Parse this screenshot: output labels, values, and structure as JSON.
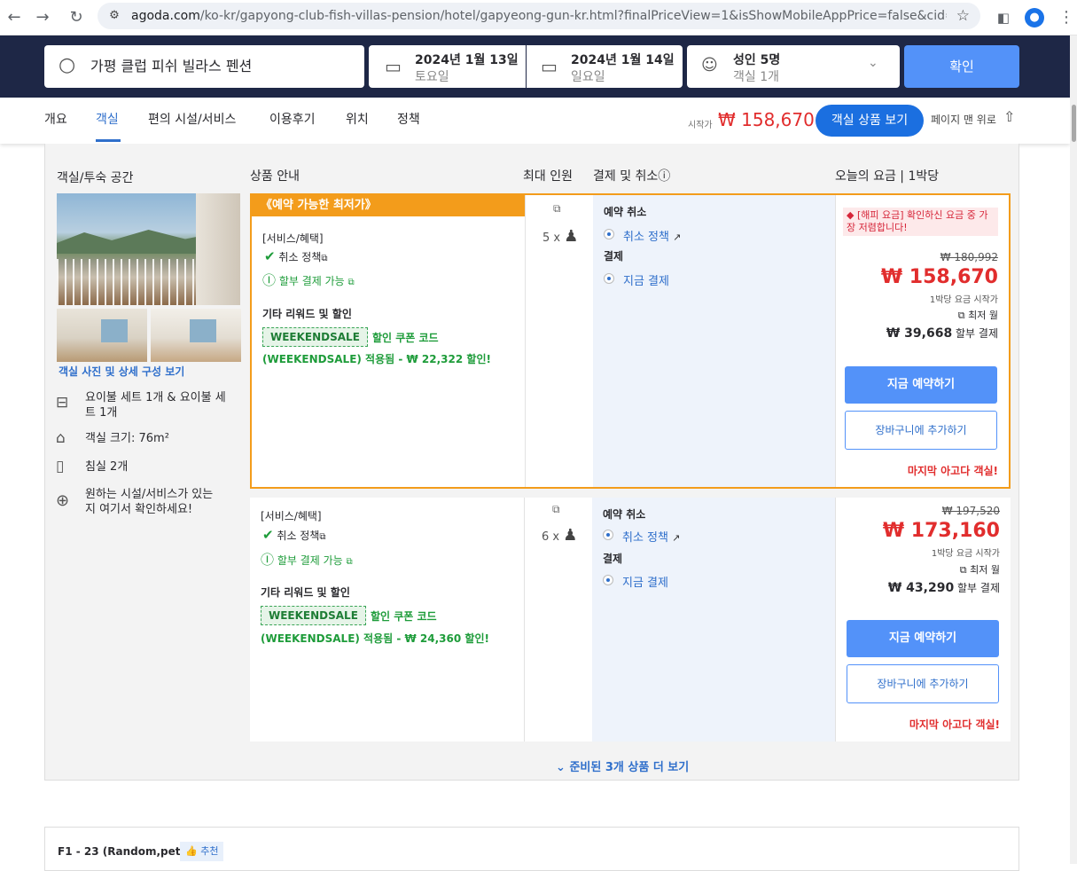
{
  "browser": {
    "url_host": "agoda.com",
    "url_path": "/ko-kr/gapyong-club-fish-villas-pension/hotel/gapyeong-gun-kr.html?finalPriceView=1&isShowMobileAppPrice=false&cid=1833981..."
  },
  "search": {
    "destination": "가평 클럽 피쉬 빌라스 펜션",
    "checkin_date": "2024년 1월 13일",
    "checkin_day": "토요일",
    "checkout_date": "2024년 1월 14일",
    "checkout_day": "일요일",
    "guests": "성인 5명",
    "rooms": "객실 1개",
    "confirm_label": "확인"
  },
  "tabs": {
    "items": [
      "개요",
      "객실",
      "편의 시설/서비스",
      "이용후기",
      "위치",
      "정책"
    ],
    "active": "객실",
    "start_label": "시작가",
    "start_price": "₩ 158,670",
    "view_rooms": "객실 상품 보기",
    "to_top": "페이지 맨 위로"
  },
  "table_headers": {
    "room": "객실/투숙 공간",
    "info": "상품 안내",
    "max_guests": "최대 인원",
    "payment": "결제 및 취소ⓘ",
    "price": "오늘의 요금 | 1박당"
  },
  "room": {
    "photo_link": "객실 사진 및 상세 구성 보기",
    "bed": "요이불 세트 1개 & 요이불 세",
    "bed2": "트 1개",
    "size": "객실 크기: 76m²",
    "bedrooms": "침실 2개",
    "facilities_1": "원하는 시설/서비스가 있는",
    "facilities_2": "지 여기서 확인하세요!"
  },
  "offers": [
    {
      "deal_badge": "《예약 가능한 최저가》",
      "services": "[서비스/혜택]",
      "cancel_policy": "취소 정책",
      "installment": "할부 결제 가능",
      "other_rewards": "기타 리워드 및 할인",
      "coupon": "WEEKENDSALE",
      "coupon_label": "할인 쿠폰 코드",
      "coupon_applied": "(WEEKENDSALE) 적용됨 - ₩ 22,322 할인!",
      "guests": "5 x",
      "cancel_title": "예약 취소",
      "cancel_opt": "취소 정책",
      "payment_title": "결제",
      "payment_opt": "지금 결제",
      "alert": "[해피 요금] 확인하신 요금 중 가장 저렴합니다!",
      "original_price": "₩ 180,992",
      "price": "₩ 158,670",
      "per_night": "1박당 요금 시작가",
      "min_month": "최저 월",
      "monthly": "₩ 39,668",
      "monthly_label": "할부 결제",
      "book": "지금 예약하기",
      "cart": "장바구니에 추가하기",
      "last_room": "마지막 아고다 객실!"
    },
    {
      "services": "[서비스/혜택]",
      "cancel_policy": "취소 정책",
      "installment": "할부 결제 가능",
      "other_rewards": "기타 리워드 및 할인",
      "coupon": "WEEKENDSALE",
      "coupon_label": "할인 쿠폰 코드",
      "coupon_applied": "(WEEKENDSALE) 적용됨 - ₩ 24,360 할인!",
      "guests": "6 x",
      "cancel_title": "예약 취소",
      "cancel_opt": "취소 정책",
      "payment_title": "결제",
      "payment_opt": "지금 결제",
      "original_price": "₩ 197,520",
      "price": "₩ 173,160",
      "per_night": "1박당 요금 시작가",
      "min_month": "최저 월",
      "monthly": "₩ 43,290",
      "monthly_label": "할부 결제",
      "book": "지금 예약하기",
      "cart": "장바구니에 추가하기",
      "last_room": "마지막 아고다 객실!"
    }
  ],
  "more_offers": "준비된 3개 상품 더 보기",
  "next_room": {
    "code": "F1 - 23 (Random,pet)",
    "recommend": "추천"
  }
}
